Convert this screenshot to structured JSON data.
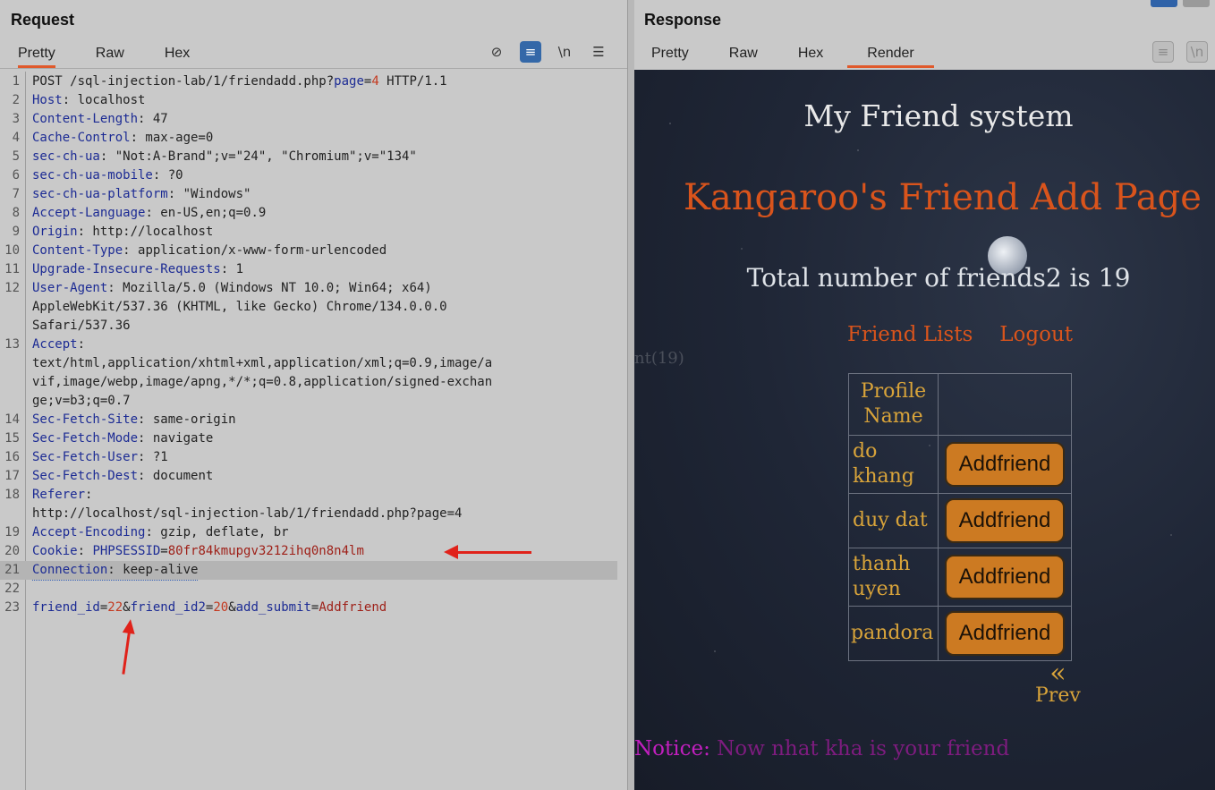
{
  "request": {
    "title": "Request",
    "tabs": [
      "Pretty",
      "Raw",
      "Hex"
    ],
    "tools": {
      "hide": "⊘",
      "wrap": "≡",
      "newline": "\\n",
      "menu": "☰"
    },
    "lines": [
      {
        "n": "1",
        "parts": [
          [
            "v",
            "POST /sql-injection-lab/1/friendadd.php?"
          ],
          [
            "k",
            "page"
          ],
          [
            "v",
            "="
          ],
          [
            "r",
            "4"
          ],
          [
            "v",
            " HTTP/1.1"
          ]
        ]
      },
      {
        "n": "2",
        "parts": [
          [
            "k",
            "Host"
          ],
          [
            "v",
            ": localhost"
          ]
        ]
      },
      {
        "n": "3",
        "parts": [
          [
            "k",
            "Content-Length"
          ],
          [
            "v",
            ": 47"
          ]
        ]
      },
      {
        "n": "4",
        "parts": [
          [
            "k",
            "Cache-Control"
          ],
          [
            "v",
            ": max-age=0"
          ]
        ]
      },
      {
        "n": "5",
        "parts": [
          [
            "k",
            "sec-ch-ua"
          ],
          [
            "v",
            ": \"Not:A-Brand\";v=\"24\", \"Chromium\";v=\"134\""
          ]
        ]
      },
      {
        "n": "6",
        "parts": [
          [
            "k",
            "sec-ch-ua-mobile"
          ],
          [
            "v",
            ": ?0"
          ]
        ]
      },
      {
        "n": "7",
        "parts": [
          [
            "k",
            "sec-ch-ua-platform"
          ],
          [
            "v",
            ": \"Windows\""
          ]
        ]
      },
      {
        "n": "8",
        "parts": [
          [
            "k",
            "Accept-Language"
          ],
          [
            "v",
            ": en-US,en;q=0.9"
          ]
        ]
      },
      {
        "n": "9",
        "parts": [
          [
            "k",
            "Origin"
          ],
          [
            "v",
            ": http://localhost"
          ]
        ]
      },
      {
        "n": "10",
        "parts": [
          [
            "k",
            "Content-Type"
          ],
          [
            "v",
            ": application/x-www-form-urlencoded"
          ]
        ]
      },
      {
        "n": "11",
        "parts": [
          [
            "k",
            "Upgrade-Insecure-Requests"
          ],
          [
            "v",
            ": 1"
          ]
        ]
      },
      {
        "n": "12",
        "parts": [
          [
            "k",
            "User-Agent"
          ],
          [
            "v",
            ": Mozilla/5.0 (Windows NT 10.0; Win64; x64)"
          ]
        ]
      },
      {
        "n": "",
        "parts": [
          [
            "v",
            "AppleWebKit/537.36 (KHTML, like Gecko) Chrome/134.0.0.0"
          ]
        ]
      },
      {
        "n": "",
        "parts": [
          [
            "v",
            "Safari/537.36"
          ]
        ]
      },
      {
        "n": "13",
        "parts": [
          [
            "k",
            "Accept"
          ],
          [
            "v",
            ":"
          ]
        ]
      },
      {
        "n": "",
        "parts": [
          [
            "v",
            "text/html,application/xhtml+xml,application/xml;q=0.9,image/a"
          ]
        ]
      },
      {
        "n": "",
        "parts": [
          [
            "v",
            "vif,image/webp,image/apng,*/*;q=0.8,application/signed-exchan"
          ]
        ]
      },
      {
        "n": "",
        "parts": [
          [
            "v",
            "ge;v=b3;q=0.7"
          ]
        ]
      },
      {
        "n": "14",
        "parts": [
          [
            "k",
            "Sec-Fetch-Site"
          ],
          [
            "v",
            ": same-origin"
          ]
        ]
      },
      {
        "n": "15",
        "parts": [
          [
            "k",
            "Sec-Fetch-Mode"
          ],
          [
            "v",
            ": navigate"
          ]
        ]
      },
      {
        "n": "16",
        "parts": [
          [
            "k",
            "Sec-Fetch-User"
          ],
          [
            "v",
            ": ?1"
          ]
        ]
      },
      {
        "n": "17",
        "parts": [
          [
            "k",
            "Sec-Fetch-Dest"
          ],
          [
            "v",
            ": document"
          ]
        ]
      },
      {
        "n": "18",
        "parts": [
          [
            "k",
            "Referer"
          ],
          [
            "v",
            ":"
          ]
        ]
      },
      {
        "n": "",
        "parts": [
          [
            "v",
            "http://localhost/sql-injection-lab/1/friendadd.php?page=4"
          ]
        ]
      },
      {
        "n": "19",
        "parts": [
          [
            "k",
            "Accept-Encoding"
          ],
          [
            "v",
            ": gzip, deflate, br"
          ]
        ]
      },
      {
        "n": "20",
        "parts": [
          [
            "k",
            "Cookie"
          ],
          [
            "v",
            ": "
          ],
          [
            "k",
            "PHPSESSID"
          ],
          [
            "v",
            "="
          ],
          [
            "dark-red",
            "80fr84kmupgv3212ihq0n8n4lm"
          ]
        ]
      },
      {
        "n": "21",
        "parts": [
          [
            "k",
            "Connection"
          ],
          [
            "v",
            ": keep-alive"
          ]
        ],
        "highlight": true
      },
      {
        "n": "22",
        "parts": []
      },
      {
        "n": "23",
        "parts": [
          [
            "k",
            "friend_id"
          ],
          [
            "v",
            "="
          ],
          [
            "r",
            "22"
          ],
          [
            "v",
            "&"
          ],
          [
            "k",
            "friend_id2"
          ],
          [
            "v",
            "="
          ],
          [
            "r",
            "20"
          ],
          [
            "v",
            "&"
          ],
          [
            "k",
            "add_submit"
          ],
          [
            "v",
            "="
          ],
          [
            "dark-red",
            "Addfriend"
          ]
        ]
      }
    ]
  },
  "response": {
    "title": "Response",
    "tabs": [
      "Pretty",
      "Raw",
      "Hex",
      "Render"
    ],
    "active_tab": "Render",
    "tools": {
      "wrap": "≡",
      "newline": "\\n"
    },
    "render": {
      "site_title": "My Friend system",
      "heading": "Kangaroo's Friend Add Page",
      "total": "Total number of friends2 is 19",
      "nav": [
        "Friend Lists",
        "Logout"
      ],
      "ghost_text": "nt(19)",
      "table_header": "Profile Name",
      "friends": [
        {
          "name": "do khang",
          "button": "Addfriend"
        },
        {
          "name": "duy dat",
          "button": "Addfriend"
        },
        {
          "name": "thanh uyen",
          "button": "Addfriend"
        },
        {
          "name": "pandora",
          "button": "Addfriend"
        }
      ],
      "prev_arrow": "«",
      "prev_label": "Prev",
      "notice_label": "Notice:",
      "notice_msg": "Now nhat kha is your friend"
    }
  }
}
